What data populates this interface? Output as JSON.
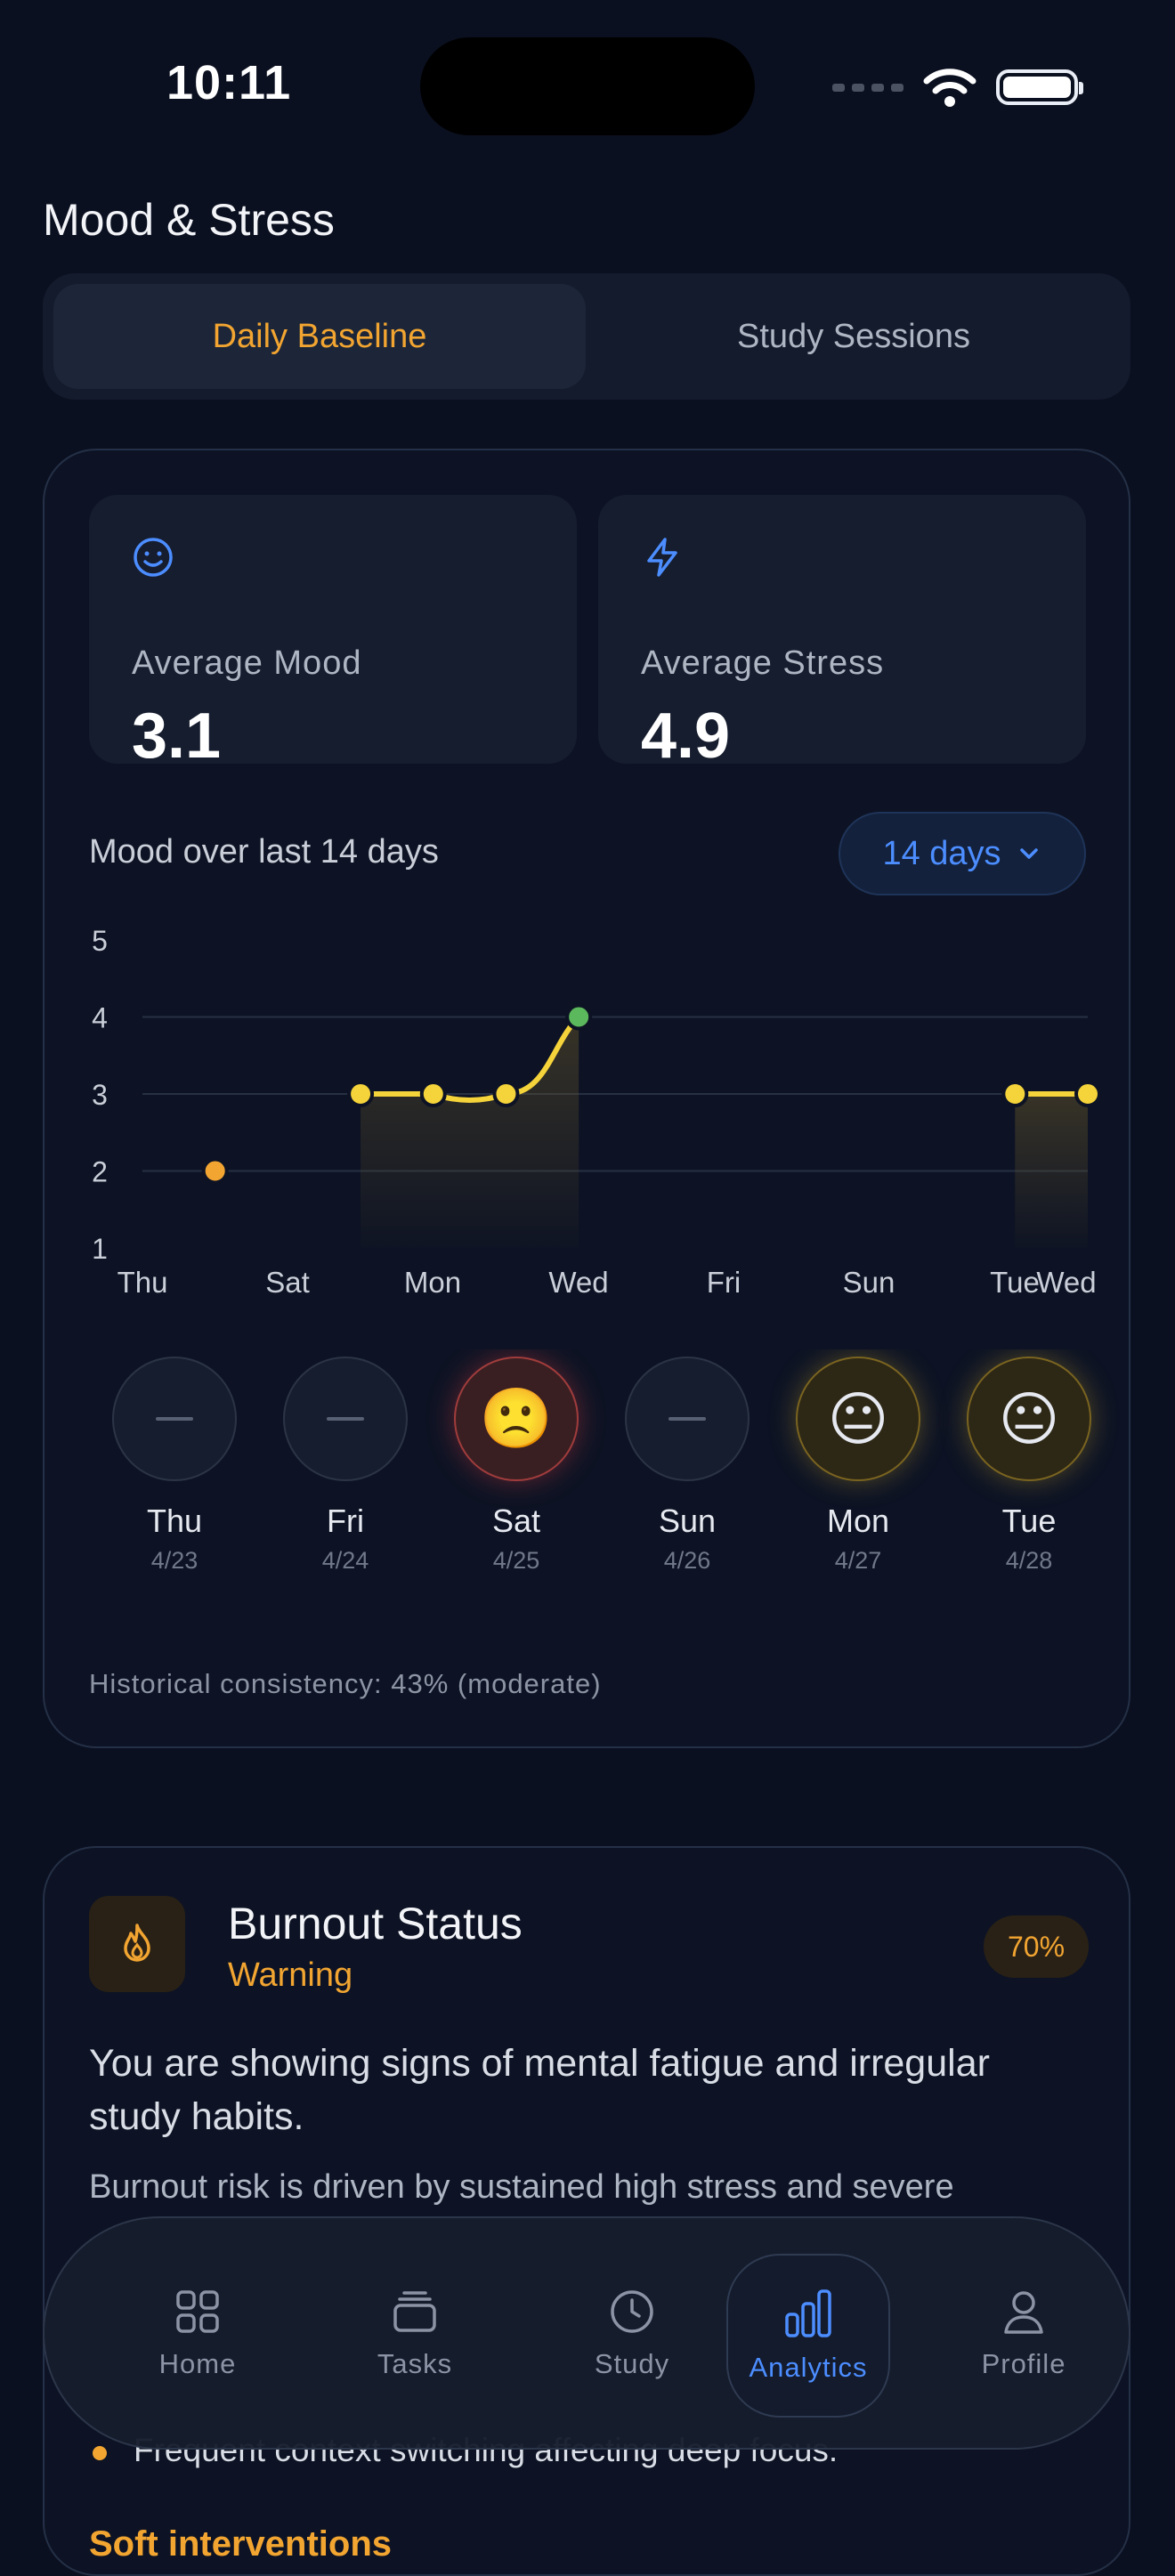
{
  "status_bar": {
    "time": "10:11"
  },
  "page_title": "Mood & Stress",
  "tabs": {
    "active": "Daily Baseline",
    "inactive": "Study Sessions"
  },
  "stats": {
    "mood": {
      "label": "Average Mood",
      "value": "3.1",
      "icon": "smile-icon"
    },
    "stress": {
      "label": "Average Stress",
      "value": "4.9",
      "icon": "lightning-icon"
    }
  },
  "chart": {
    "title": "Mood over last 14 days",
    "range_label": "14 days",
    "accent": "#4c8dff"
  },
  "chart_data": {
    "type": "line",
    "ylim": [
      1,
      5
    ],
    "yticks": [
      "5",
      "4",
      "3",
      "2",
      "1"
    ],
    "xticks": [
      "Thu",
      "Sat",
      "Mon",
      "Wed",
      "Fri",
      "Sun",
      "Tue",
      "Wed"
    ],
    "points": [
      {
        "day": 2,
        "value": 2
      },
      {
        "day": 4,
        "value": 3
      },
      {
        "day": 5,
        "value": 3
      },
      {
        "day": 6,
        "value": 3
      },
      {
        "day": 7,
        "value": 4
      },
      {
        "day": 13,
        "value": 3
      },
      {
        "day": 14,
        "value": 3
      }
    ],
    "colors": {
      "line": "#f5d33a",
      "low": "#f2a531",
      "high": "#5cb85c"
    }
  },
  "days": [
    {
      "name": "Thu",
      "date": "4/23",
      "state": "none"
    },
    {
      "name": "Fri",
      "date": "4/24",
      "state": "none"
    },
    {
      "name": "Sat",
      "date": "4/25",
      "state": "sad"
    },
    {
      "name": "Sun",
      "date": "4/26",
      "state": "none"
    },
    {
      "name": "Mon",
      "date": "4/27",
      "state": "neutral"
    },
    {
      "name": "Tue",
      "date": "4/28",
      "state": "neutral"
    }
  ],
  "emoji": {
    "sad": "🙁",
    "neutral": "😐"
  },
  "consistency": "Historical consistency: 43% (moderate)",
  "burnout": {
    "title": "Burnout Status",
    "status": "Warning",
    "percent": "70%",
    "headline": "You are showing signs of mental fatigue and irregular study habits.",
    "description": "Burnout risk is driven by sustained high stress and severe",
    "bullet": "Frequent context switching affecting deep focus.",
    "section": "Soft interventions"
  },
  "nav": [
    {
      "label": "Home",
      "icon": "grid-icon"
    },
    {
      "label": "Tasks",
      "icon": "stack-icon"
    },
    {
      "label": "Study",
      "icon": "clock-icon"
    },
    {
      "label": "Analytics",
      "icon": "bar-chart-icon",
      "active": true
    },
    {
      "label": "Profile",
      "icon": "person-icon"
    }
  ]
}
